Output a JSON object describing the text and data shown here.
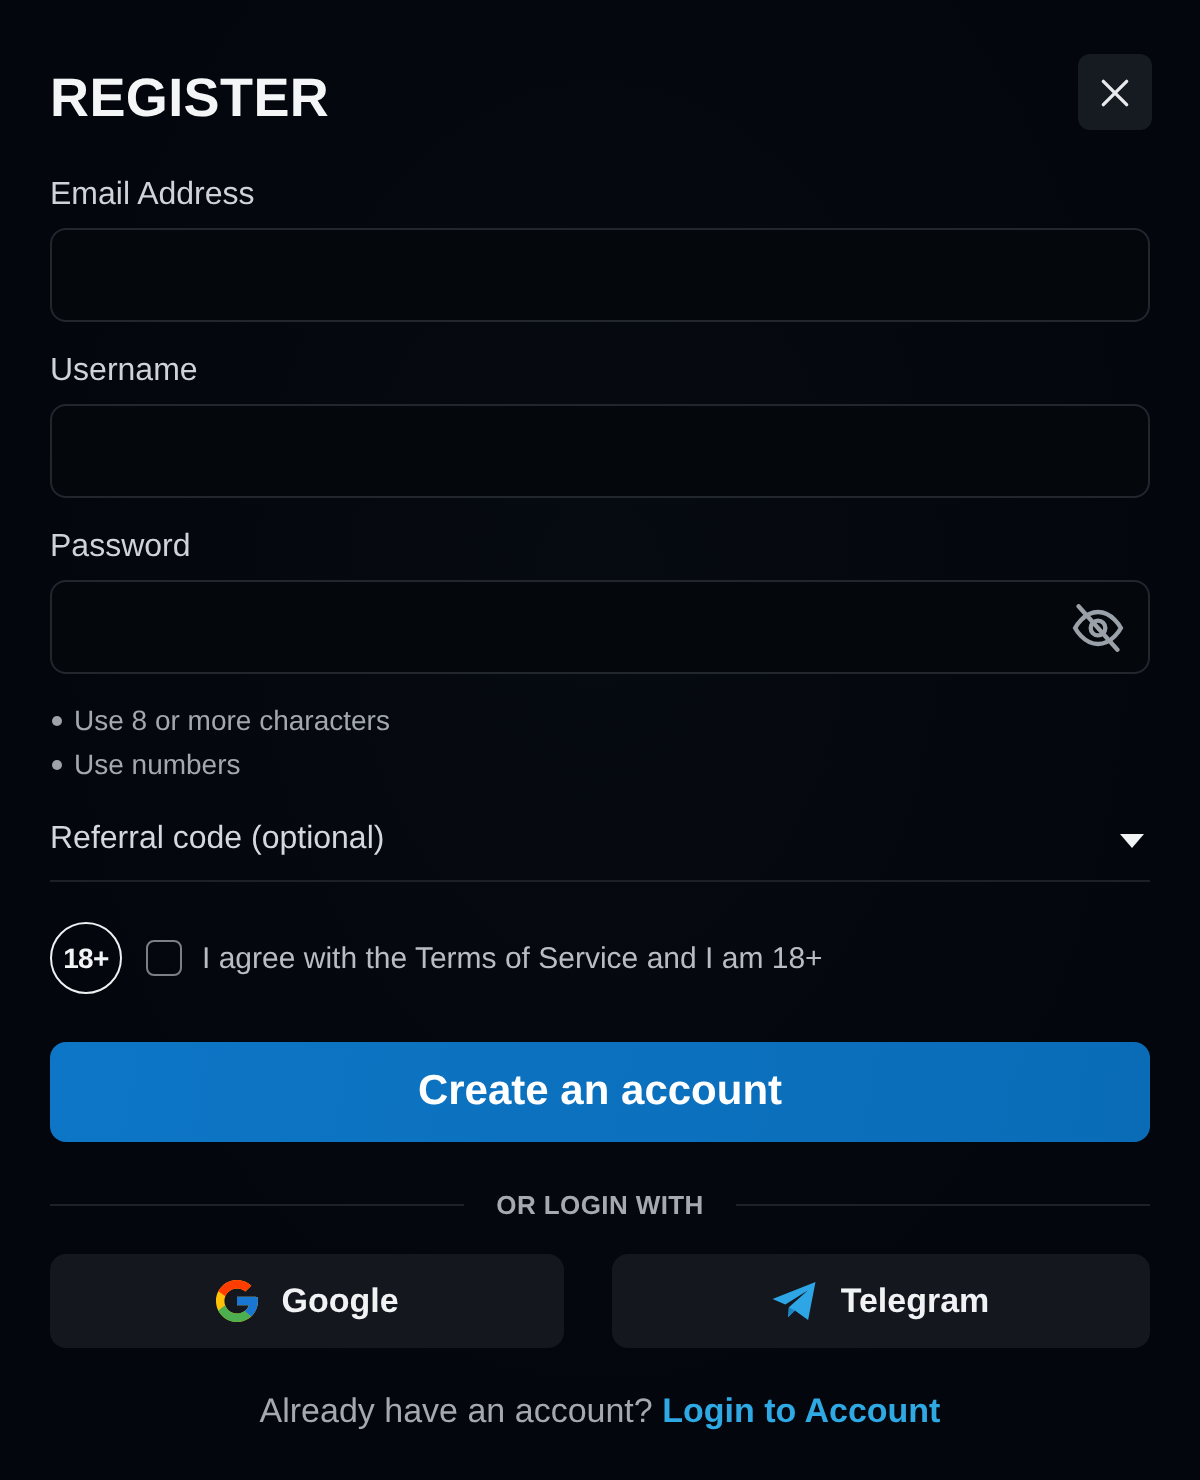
{
  "dialog": {
    "title": "REGISTER"
  },
  "fields": [
    {
      "label": "Email Address",
      "kind": "text"
    },
    {
      "label": "Username",
      "kind": "text"
    },
    {
      "label": "Password",
      "kind": "password",
      "visible": false
    }
  ],
  "password_hints": [
    "Use 8 or more characters",
    "Use numbers"
  ],
  "referral": {
    "label": "Referral code (optional)",
    "expanded": false
  },
  "agreement": {
    "badge": "18+",
    "text": "I agree with the Terms of Service and I am 18+",
    "checked": false
  },
  "submit_button": "Create an account",
  "divider_text": "OR LOGIN WITH",
  "social_buttons": [
    {
      "label": "Google",
      "kind": "google"
    },
    {
      "label": "Telegram",
      "kind": "telegram"
    }
  ],
  "footer": {
    "text": "Already have an account?",
    "link": "Login to Account"
  }
}
